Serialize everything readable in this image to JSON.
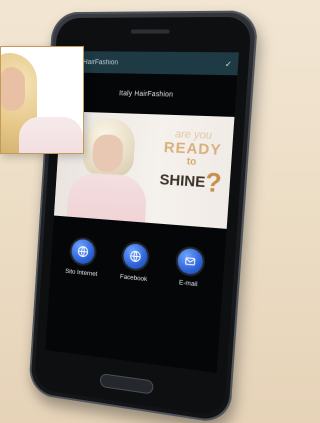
{
  "app": {
    "status_title": "HairFashion"
  },
  "screen": {
    "brand": "Italy HairFashion",
    "tagline": {
      "line1": "are you",
      "line2": "READY",
      "line3": "to",
      "line4": "SHINE",
      "mark": "?"
    },
    "actions": [
      {
        "label": "Sito Internet",
        "icon": "globe-icon"
      },
      {
        "label": "Facebook",
        "icon": "globe-icon"
      },
      {
        "label": "E-mail",
        "icon": "mail-icon"
      }
    ]
  },
  "colors": {
    "background": "#efe1cc",
    "phone_body": "#1f2226",
    "status_bar": "#1e3a44",
    "action_blue": "#2d63d6",
    "card_border": "#c39a57"
  }
}
